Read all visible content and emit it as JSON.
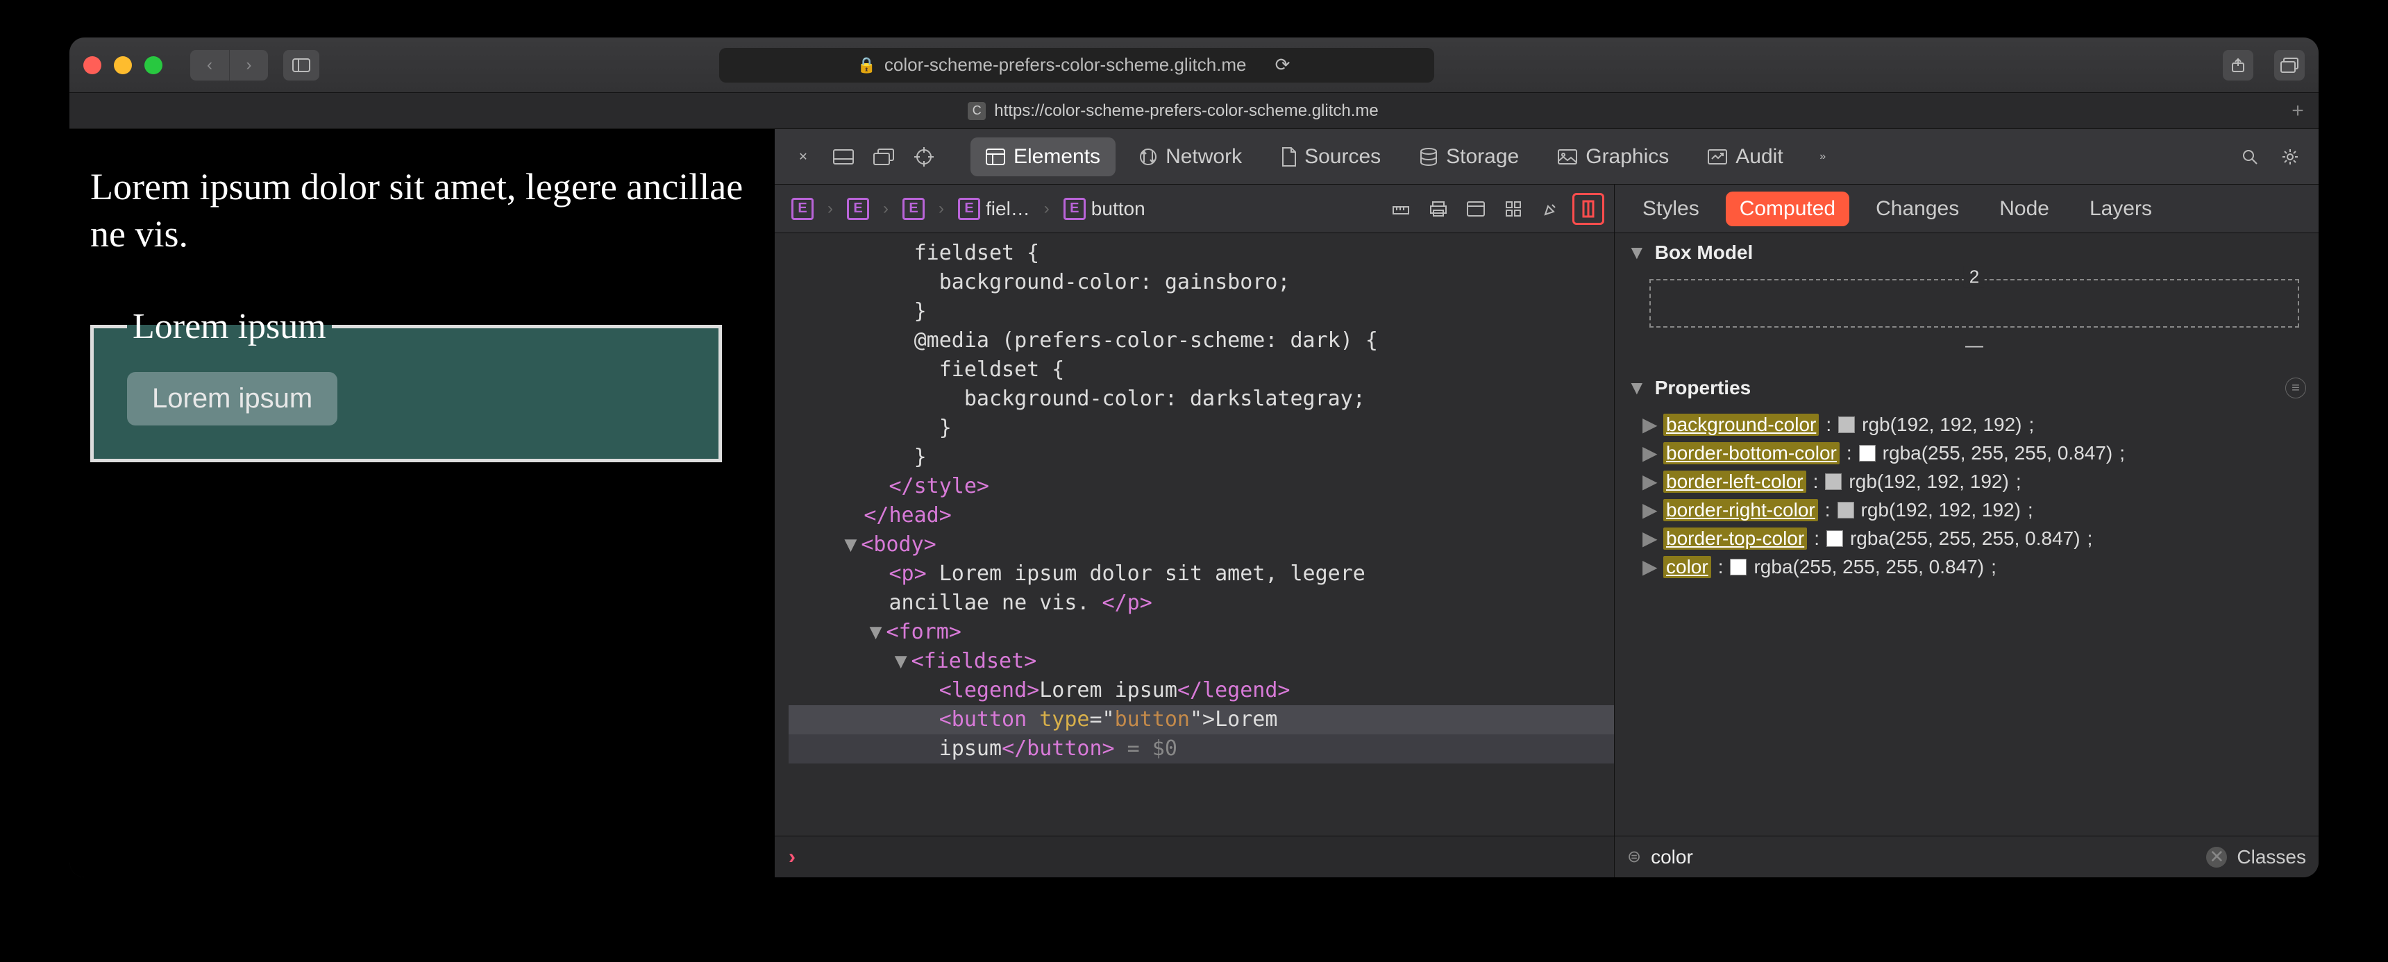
{
  "titlebar": {
    "url_display": "color-scheme-prefers-color-scheme.glitch.me"
  },
  "tab": {
    "label": "https://color-scheme-prefers-color-scheme.glitch.me"
  },
  "page": {
    "paragraph": "Lorem ipsum dolor sit amet, legere ancillae ne vis.",
    "legend": "Lorem ipsum",
    "button": "Lorem ipsum"
  },
  "devtools": {
    "tabs": {
      "elements": "Elements",
      "network": "Network",
      "sources": "Sources",
      "storage": "Storage",
      "graphics": "Graphics",
      "audit": "Audit"
    },
    "breadcrumb": {
      "item3": "fiel…",
      "item4": "button"
    },
    "source": {
      "l1": "          fieldset {",
      "l2": "            background-color: gainsboro;",
      "l3": "          }",
      "l4": "          @media (prefers-color-scheme: dark) {",
      "l5": "            fieldset {",
      "l6": "              background-color: darkslategray;",
      "l7": "            }",
      "l8": "          }",
      "style_close": "</style>",
      "head_close": "</head>",
      "body_open": "<body>",
      "p_open": "<p>",
      "p_text": " Lorem ipsum dolor sit amet, legere ",
      "p_text2": "ancillae ne vis. ",
      "p_close": "</p>",
      "form_open": "<form>",
      "fieldset_open": "<fieldset>",
      "legend_open": "<legend>",
      "legend_text": "Lorem ipsum",
      "legend_close": "</legend>",
      "button_open": "<button ",
      "button_attr": "type",
      "button_eq": "=\"",
      "button_val": "button",
      "button_end": "\">",
      "button_text": "Lorem ",
      "button_text2": "ipsum",
      "button_close": "</button>",
      "dollar": " = $0"
    }
  },
  "styles": {
    "tabs": {
      "styles": "Styles",
      "computed": "Computed",
      "changes": "Changes",
      "node": "Node",
      "layers": "Layers"
    },
    "box_model_label": "Box Model",
    "box_top": "2",
    "box_dash": "—",
    "properties_label": "Properties",
    "props": [
      {
        "name": "background-color",
        "value": "rgb(192, 192, 192)",
        "swatch": "#c0c0c0"
      },
      {
        "name": "border-bottom-color",
        "value": "rgba(255, 255, 255, 0.847)",
        "swatch": "#ffffff"
      },
      {
        "name": "border-left-color",
        "value": "rgb(192, 192, 192)",
        "swatch": "#c0c0c0"
      },
      {
        "name": "border-right-color",
        "value": "rgb(192, 192, 192)",
        "swatch": "#c0c0c0"
      },
      {
        "name": "border-top-color",
        "value": "rgba(255, 255, 255, 0.847)",
        "swatch": "#ffffff"
      },
      {
        "name": "color",
        "value": "rgba(255, 255, 255, 0.847)",
        "swatch": "#ffffff"
      }
    ],
    "filter_value": "color",
    "classes_btn": "Classes"
  }
}
